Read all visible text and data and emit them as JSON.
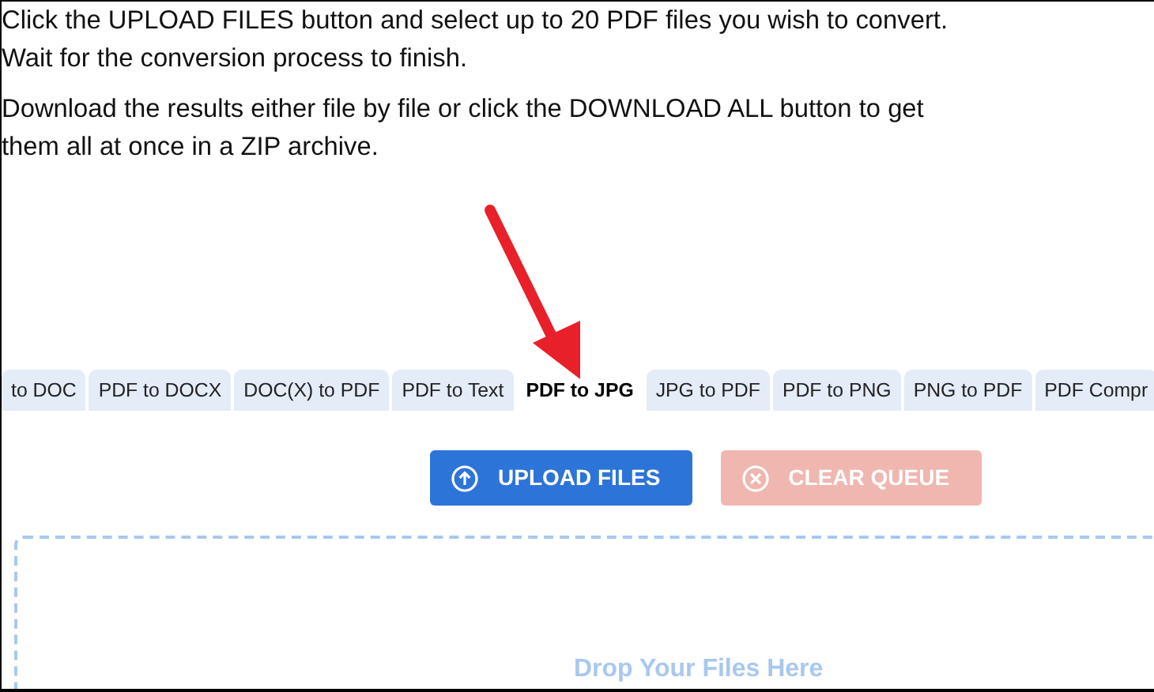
{
  "instructions": [
    "Click the UPLOAD FILES button and select up to 20 PDF files you wish to convert. Wait for the conversion process to finish.",
    "Download the results either file by file or click the DOWNLOAD ALL button to get them all at once in a ZIP archive."
  ],
  "tabs": [
    {
      "label": "to DOC",
      "selected": false
    },
    {
      "label": "PDF to DOCX",
      "selected": false
    },
    {
      "label": "DOC(X) to PDF",
      "selected": false
    },
    {
      "label": "PDF to Text",
      "selected": false
    },
    {
      "label": "PDF to JPG",
      "selected": true
    },
    {
      "label": "JPG to PDF",
      "selected": false
    },
    {
      "label": "PDF to PNG",
      "selected": false
    },
    {
      "label": "PNG to PDF",
      "selected": false
    },
    {
      "label": "PDF Compr",
      "selected": false
    }
  ],
  "buttons": [
    {
      "kind": "upload",
      "label": "UPLOAD FILES",
      "disabled": false
    },
    {
      "kind": "clear",
      "label": "CLEAR QUEUE",
      "disabled": true
    }
  ],
  "drop_zone": {
    "label": "Drop Your Files Here"
  }
}
